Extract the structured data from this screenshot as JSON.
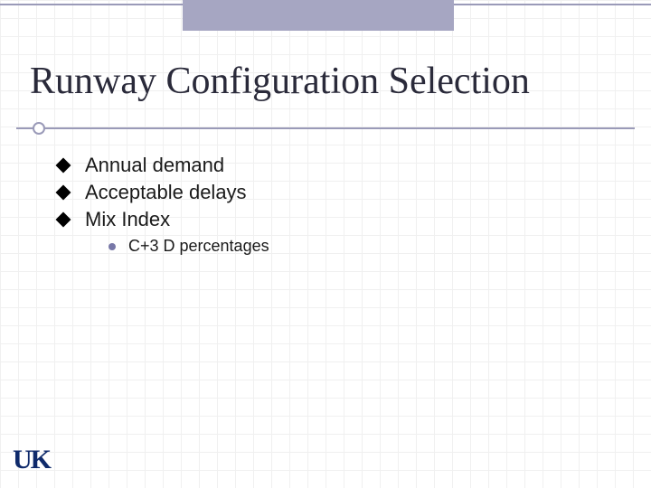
{
  "title": "Runway Configuration Selection",
  "bullets": [
    {
      "label": "Annual demand"
    },
    {
      "label": "Acceptable delays"
    },
    {
      "label": "Mix Index",
      "sub": [
        {
          "label": "C+3 D percentages"
        }
      ]
    }
  ],
  "logo": "UK"
}
